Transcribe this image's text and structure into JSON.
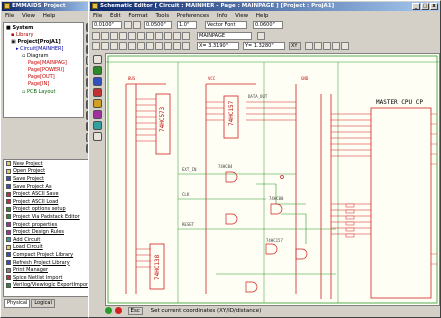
{
  "project_window": {
    "title": "EMMAIDS Project",
    "menu": [
      "File",
      "View",
      "Help"
    ],
    "tree": {
      "root": "System",
      "library": "Library",
      "project": "Project[ProjA1]",
      "circuit": "Circuit[MAINHER]",
      "diagram": "Diagram",
      "pages": [
        "Page[MAINPAG]",
        "Page[POWERI]",
        "Page[OUT]",
        "Page[IN]"
      ],
      "pcb": "PCB Layout"
    },
    "actions": [
      "New Project",
      "Open Project",
      "Save Project",
      "Save Project As",
      "Project ASCII Save",
      "Project ASCII Load",
      "Project options setup",
      "Project Via Padstack Editor",
      "Project properties",
      "Project Design Rules",
      "Add Circuit",
      "Load Circuit",
      "Compact Project Library",
      "Refresh Project Library",
      "Print Manager",
      "Spice Netlist Import",
      "Verilog/Viewlogic ExportImport"
    ],
    "tabs": [
      "Physical",
      "Logical"
    ]
  },
  "editor_window": {
    "title": "Schematic Editor [ Circuit : MAINHER - Page : MAINPAGE ] [Project : ProjA1]",
    "menu": [
      "File",
      "Edit",
      "Format",
      "Tools",
      "Preferences",
      "Info",
      "View",
      "Help"
    ],
    "grid_value": "0.0100\"",
    "line_width": "0.0500\"",
    "angle": "1.0\"",
    "font": "Vector Font",
    "text_size": "0.0600\"",
    "page_select": "MAINPAGE",
    "coord_x": "X= 3.3190\"",
    "coord_y": "Y= 1.3280\"",
    "xy_button": "XY",
    "status_text": "Set current coordinates (XY/ID/distance)",
    "esc_label": "Esc"
  },
  "schematic": {
    "title_block": "MASTER CPU CP",
    "chips": [
      "74HC573",
      "74HC157",
      "74HC157",
      "74HC138",
      "74HC04",
      "74HC00"
    ],
    "nets": [
      "BUS",
      "VCC",
      "GND",
      "DATA_OUT",
      "EXT_IN",
      "CLK",
      "RESET"
    ]
  }
}
